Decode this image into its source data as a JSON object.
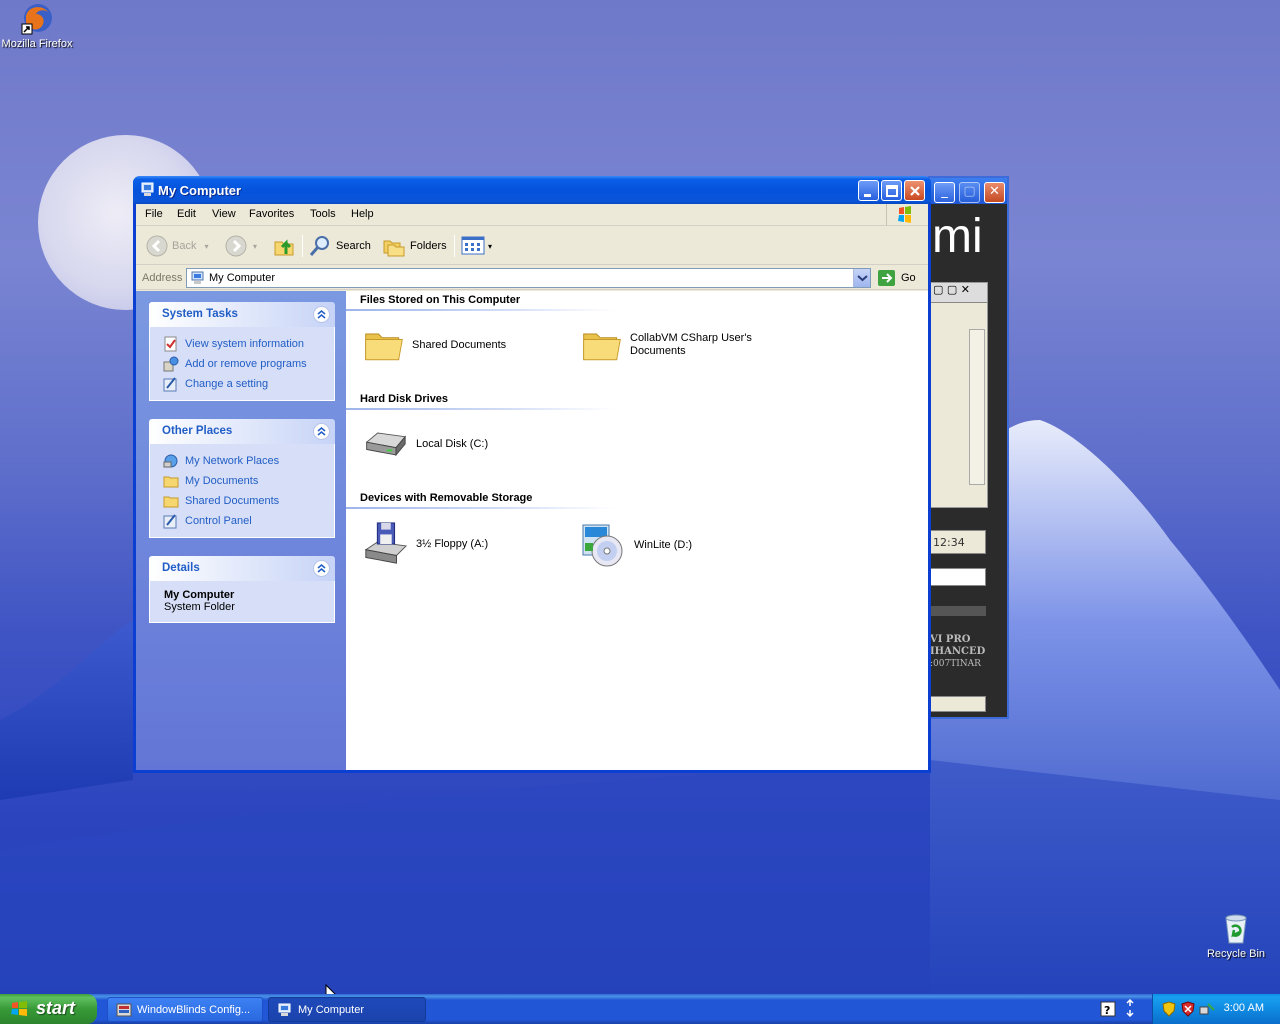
{
  "desktop": {
    "icons": [
      {
        "label": "Mozilla Firefox",
        "icon": "firefox-icon"
      },
      {
        "label": "Recycle Bin",
        "icon": "recycle-bin-icon"
      }
    ]
  },
  "background_window": {
    "title_fragment": "mi",
    "time_text": "12:34",
    "text_lines": [
      "VI PRO",
      "IHANCED",
      ":007TINAR"
    ]
  },
  "window": {
    "title": "My Computer",
    "menu": [
      "File",
      "Edit",
      "View",
      "Favorites",
      "Tools",
      "Help"
    ],
    "toolbar": {
      "back": "Back",
      "search": "Search",
      "folders": "Folders"
    },
    "address": {
      "label": "Address",
      "value": "My Computer",
      "go": "Go"
    },
    "left_pane": {
      "system_tasks": {
        "title": "System Tasks",
        "links": [
          {
            "label": "View system information",
            "icon": "system-info-icon"
          },
          {
            "label": "Add or remove programs",
            "icon": "add-remove-icon"
          },
          {
            "label": "Change a setting",
            "icon": "control-panel-icon"
          }
        ]
      },
      "other_places": {
        "title": "Other Places",
        "links": [
          {
            "label": "My Network Places",
            "icon": "network-places-icon"
          },
          {
            "label": "My Documents",
            "icon": "folder-icon"
          },
          {
            "label": "Shared Documents",
            "icon": "folder-icon"
          },
          {
            "label": "Control Panel",
            "icon": "control-panel-icon"
          }
        ]
      },
      "details": {
        "title": "Details",
        "name": "My Computer",
        "type": "System Folder"
      }
    },
    "groups": [
      {
        "title": "Files Stored on This Computer",
        "items": [
          {
            "label": "Shared Documents",
            "icon": "folder-icon"
          },
          {
            "label": "CollabVM CSharp User's Documents",
            "line1": "CollabVM CSharp User's",
            "line2": "Documents",
            "icon": "folder-icon"
          }
        ]
      },
      {
        "title": "Hard Disk Drives",
        "items": [
          {
            "label": "Local Disk (C:)",
            "icon": "hard-disk-icon"
          }
        ]
      },
      {
        "title": "Devices with Removable Storage",
        "items": [
          {
            "label": "3½ Floppy (A:)",
            "icon": "floppy-drive-icon"
          },
          {
            "label": "WinLite (D:)",
            "icon": "cd-drive-icon"
          }
        ]
      }
    ]
  },
  "taskbar": {
    "start": "start",
    "buttons": [
      {
        "label": "WindowBlinds Config...",
        "active": false
      },
      {
        "label": "My Computer",
        "active": true
      }
    ],
    "clock": "3:00 AM"
  },
  "colors": {
    "title_blue": "#0553dc",
    "link_blue": "#215dc6",
    "start_green": "#379a37",
    "tray_blue": "#0f8ae2"
  }
}
